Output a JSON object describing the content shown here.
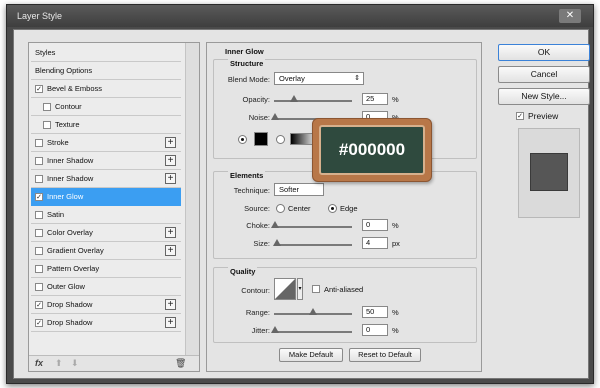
{
  "window": {
    "title": "Layer Style",
    "close_glyph": "✕"
  },
  "left_list": {
    "items": [
      {
        "label": "Styles",
        "checkbox": false,
        "checked": false,
        "plus": false,
        "indent": false
      },
      {
        "label": "Blending Options",
        "checkbox": false,
        "checked": false,
        "plus": false,
        "indent": false
      },
      {
        "label": "Bevel & Emboss",
        "checkbox": true,
        "checked": true,
        "plus": false,
        "indent": false
      },
      {
        "label": "Contour",
        "checkbox": true,
        "checked": false,
        "plus": false,
        "indent": true
      },
      {
        "label": "Texture",
        "checkbox": true,
        "checked": false,
        "plus": false,
        "indent": true
      },
      {
        "label": "Stroke",
        "checkbox": true,
        "checked": false,
        "plus": true,
        "indent": false
      },
      {
        "label": "Inner Shadow",
        "checkbox": true,
        "checked": false,
        "plus": true,
        "indent": false
      },
      {
        "label": "Inner Shadow",
        "checkbox": true,
        "checked": false,
        "plus": true,
        "indent": false
      },
      {
        "label": "Inner Glow",
        "checkbox": true,
        "checked": true,
        "plus": false,
        "indent": false,
        "selected": true
      },
      {
        "label": "Satin",
        "checkbox": true,
        "checked": false,
        "plus": false,
        "indent": false
      },
      {
        "label": "Color Overlay",
        "checkbox": true,
        "checked": false,
        "plus": true,
        "indent": false
      },
      {
        "label": "Gradient Overlay",
        "checkbox": true,
        "checked": false,
        "plus": true,
        "indent": false
      },
      {
        "label": "Pattern Overlay",
        "checkbox": true,
        "checked": false,
        "plus": false,
        "indent": false
      },
      {
        "label": "Outer Glow",
        "checkbox": true,
        "checked": false,
        "plus": false,
        "indent": false
      },
      {
        "label": "Drop Shadow",
        "checkbox": true,
        "checked": true,
        "plus": true,
        "indent": false
      },
      {
        "label": "Drop Shadow",
        "checkbox": true,
        "checked": true,
        "plus": true,
        "indent": false
      }
    ],
    "toolbar": {
      "fx": "fx",
      "up": "⬆",
      "down": "⬇",
      "trash": "🗑"
    }
  },
  "inner_glow": {
    "title": "Inner Glow",
    "structure": {
      "title": "Structure",
      "blend_mode_label": "Blend Mode:",
      "blend_mode_value": "Overlay",
      "opacity_label": "Opacity:",
      "opacity_value": "25",
      "opacity_level": 0.25,
      "noise_label": "Noise:",
      "noise_value": "0",
      "noise_level": 0,
      "unit_percent": "%",
      "color": "#000000"
    },
    "elements": {
      "title": "Elements",
      "technique_label": "Technique:",
      "technique_value": "Softer",
      "source_label": "Source:",
      "source_center": "Center",
      "source_edge": "Edge",
      "choke_label": "Choke:",
      "choke_value": "0",
      "size_label": "Size:",
      "size_value": "4",
      "unit_px": "px"
    },
    "quality": {
      "title": "Quality",
      "contour_label": "Contour:",
      "anti_aliased": "Anti-aliased",
      "range_label": "Range:",
      "range_value": "50",
      "range_level": 0.5,
      "jitter_label": "Jitter:",
      "jitter_value": "0",
      "jitter_level": 0
    },
    "make_default": "Make Default",
    "reset_default": "Reset to Default"
  },
  "right": {
    "ok": "OK",
    "cancel": "Cancel",
    "new_style": "New Style...",
    "preview_label": "Preview",
    "preview_checked": true
  },
  "tooltip": {
    "text": "#000000"
  }
}
